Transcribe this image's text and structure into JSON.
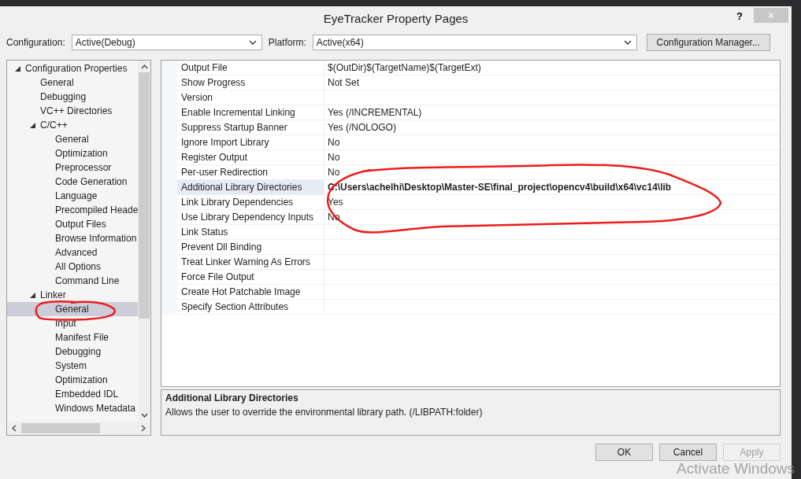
{
  "window": {
    "title": "EyeTracker Property Pages",
    "help": "?",
    "close": "✕"
  },
  "toolbar": {
    "configuration_label": "Configuration:",
    "configuration_value": "Active(Debug)",
    "platform_label": "Platform:",
    "platform_value": "Active(x64)",
    "manager_button": "Configuration Manager..."
  },
  "tree": [
    {
      "label": "Configuration Properties",
      "expanded": true,
      "selected": false,
      "children": [
        {
          "label": "General",
          "selected": false
        },
        {
          "label": "Debugging",
          "selected": false
        },
        {
          "label": "VC++ Directories",
          "selected": false
        },
        {
          "label": "C/C++",
          "expanded": true,
          "selected": false,
          "children": [
            {
              "label": "General",
              "selected": false
            },
            {
              "label": "Optimization",
              "selected": false
            },
            {
              "label": "Preprocessor",
              "selected": false
            },
            {
              "label": "Code Generation",
              "selected": false
            },
            {
              "label": "Language",
              "selected": false
            },
            {
              "label": "Precompiled Heade",
              "selected": false
            },
            {
              "label": "Output Files",
              "selected": false
            },
            {
              "label": "Browse Information",
              "selected": false
            },
            {
              "label": "Advanced",
              "selected": false
            },
            {
              "label": "All Options",
              "selected": false
            },
            {
              "label": "Command Line",
              "selected": false
            }
          ]
        },
        {
          "label": "Linker",
          "expanded": true,
          "selected": false,
          "children": [
            {
              "label": "General",
              "selected": true
            },
            {
              "label": "Input",
              "selected": false
            },
            {
              "label": "Manifest File",
              "selected": false
            },
            {
              "label": "Debugging",
              "selected": false
            },
            {
              "label": "System",
              "selected": false
            },
            {
              "label": "Optimization",
              "selected": false
            },
            {
              "label": "Embedded IDL",
              "selected": false
            },
            {
              "label": "Windows Metadata",
              "selected": false
            }
          ]
        }
      ]
    }
  ],
  "properties": [
    {
      "name": "Output File",
      "value": "$(OutDir)$(TargetName)$(TargetExt)",
      "modified": false,
      "selected": false
    },
    {
      "name": "Show Progress",
      "value": "Not Set",
      "modified": false,
      "selected": false
    },
    {
      "name": "Version",
      "selected": false
    },
    {
      "name": "Enable Incremental Linking",
      "value": "Yes (/INCREMENTAL)",
      "modified": false,
      "selected": false
    },
    {
      "name": "Suppress Startup Banner",
      "value": "Yes (/NOLOGO)",
      "modified": false,
      "selected": false
    },
    {
      "name": "Ignore Import Library",
      "value": "No",
      "modified": false,
      "selected": false
    },
    {
      "name": "Register Output",
      "value": "No",
      "modified": false,
      "selected": false
    },
    {
      "name": "Per-user Redirection",
      "value": "No",
      "modified": false,
      "selected": false
    },
    {
      "name": "Additional Library Directories",
      "value": "C:\\Users\\achelhi\\Desktop\\Master-SE\\final_project\\opencv4\\build\\x64\\vc14\\lib",
      "modified": true,
      "selected": true
    },
    {
      "name": "Link Library Dependencies",
      "value": "Yes",
      "modified": false,
      "selected": false
    },
    {
      "name": "Use Library Dependency Inputs",
      "value": "No",
      "modified": false,
      "selected": false
    },
    {
      "name": "Link Status",
      "selected": false
    },
    {
      "name": "Prevent Dll Binding",
      "selected": false
    },
    {
      "name": "Treat Linker Warning As Errors",
      "selected": false
    },
    {
      "name": "Force File Output",
      "selected": false
    },
    {
      "name": "Create Hot Patchable Image",
      "selected": false
    },
    {
      "name": "Specify Section Attributes",
      "selected": false
    }
  ],
  "description": {
    "title": "Additional Library Directories",
    "text": "Allows the user to override the environmental library path. (/LIBPATH:folder)"
  },
  "buttons": [
    {
      "label": "OK",
      "disabled": false
    },
    {
      "label": "Cancel",
      "disabled": false
    },
    {
      "label": "Apply",
      "disabled": true
    }
  ],
  "os_notice": "Activate Windows"
}
